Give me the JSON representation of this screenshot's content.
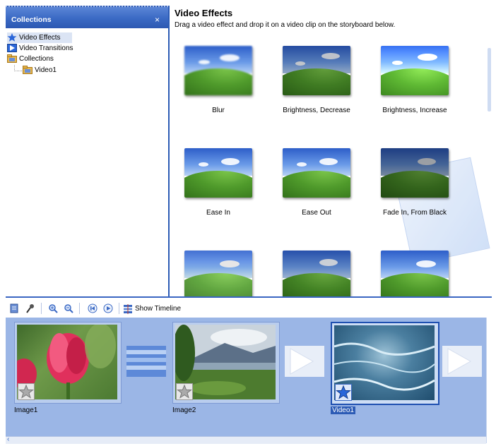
{
  "collections_pane": {
    "title": "Collections",
    "close_glyph": "×",
    "tree": [
      {
        "label": "Video Effects",
        "icon": "video-effects-star-icon",
        "selected": true
      },
      {
        "label": "Video Transitions",
        "icon": "video-transitions-icon",
        "selected": false
      },
      {
        "label": "Collections",
        "icon": "collections-folder-icon",
        "selected": false
      },
      {
        "label": "Video1",
        "icon": "collection-folder-icon",
        "selected": false
      }
    ]
  },
  "effects_pane": {
    "title": "Video Effects",
    "subtitle": "Drag a video effect and drop it on a video clip on the storyboard below.",
    "effects": [
      {
        "label": "Blur"
      },
      {
        "label": "Brightness, Decrease"
      },
      {
        "label": "Brightness, Increase"
      },
      {
        "label": "Ease In"
      },
      {
        "label": "Ease Out"
      },
      {
        "label": "Fade In, From Black"
      },
      {
        "label": ""
      },
      {
        "label": ""
      },
      {
        "label": ""
      }
    ]
  },
  "toolbar": {
    "show_timeline_label": "Show Timeline",
    "icons": [
      "storyboard-icon",
      "narrate-icon",
      "zoom-in-icon",
      "zoom-out-icon",
      "rewind-icon",
      "play-icon",
      "timeline-icon"
    ]
  },
  "storyboard": {
    "clips": [
      {
        "label": "Image1",
        "icon": "effect-star-icon"
      },
      {
        "label": "Image2",
        "icon": "effect-star-icon"
      },
      {
        "label": "Video1",
        "icon": "effect-star-icon",
        "selected": true
      }
    ]
  },
  "colors": {
    "accent": "#3a69c4",
    "storyboard_bg": "#9bb6e6",
    "selection": "#2c5bb5"
  }
}
